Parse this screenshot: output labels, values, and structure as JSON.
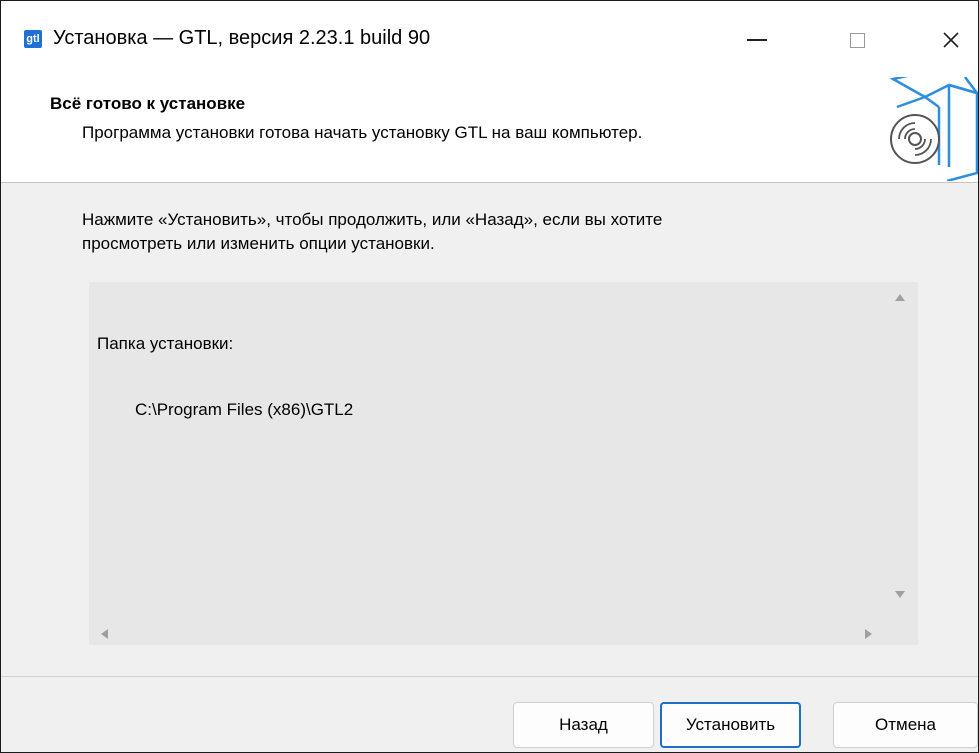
{
  "window": {
    "icon_text": "gtl",
    "title": "Установка — GTL, версия 2.23.1 build 90",
    "controls": {
      "close_glyph": "✕"
    }
  },
  "header": {
    "title": "Всё готово к установке",
    "subtitle": "Программа установки готова начать установку GTL на ваш компьютер."
  },
  "body": {
    "intro_line1": "Нажмите «Установить», чтобы продолжить, или «Назад», если вы хотите",
    "intro_line2": "просмотреть или изменить опции установки.",
    "memo": {
      "label": "Папка установки:",
      "path": "C:\\Program Files (x86)\\GTL2"
    }
  },
  "buttons": {
    "back": "Назад",
    "install": "Установить",
    "cancel": "Отмена"
  },
  "colors": {
    "accent": "#1f6fc4",
    "app_icon": "#1e6fd6"
  },
  "icons": [
    "app-icon",
    "minimize-icon",
    "maximize-icon",
    "close-icon",
    "install-box-disc-icon",
    "scroll-up-icon",
    "scroll-down-icon",
    "scroll-left-icon",
    "scroll-right-icon"
  ]
}
